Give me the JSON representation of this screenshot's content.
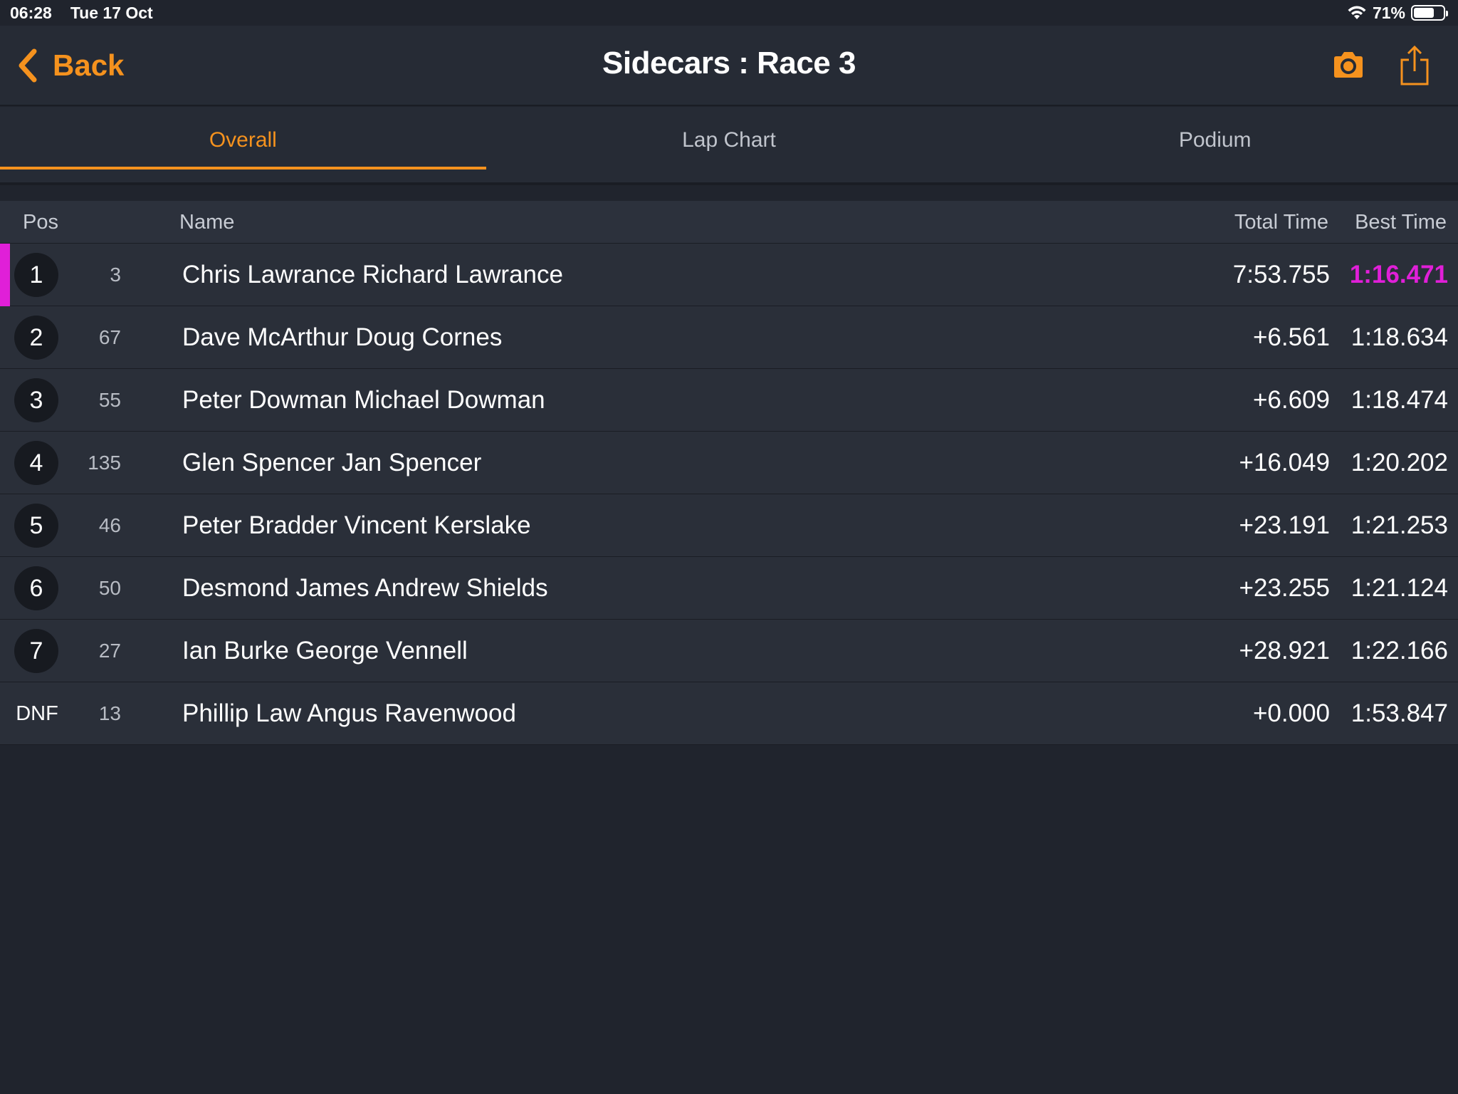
{
  "status_bar": {
    "time": "06:28",
    "date": "Tue 17 Oct",
    "battery": "71%",
    "battery_level": 0.71
  },
  "nav": {
    "back_label": "Back",
    "title": "Sidecars : Race 3",
    "accent_color": "#f5921e"
  },
  "tabs": [
    {
      "label": "Overall",
      "active": true
    },
    {
      "label": "Lap Chart",
      "active": false
    },
    {
      "label": "Podium",
      "active": false
    }
  ],
  "table": {
    "headers": {
      "pos": "Pos",
      "name": "Name",
      "total": "Total Time",
      "best": "Best Time"
    },
    "fastest_color": "#e01fd8",
    "rows": [
      {
        "pos": "1",
        "number": "3",
        "name": "Chris Lawrance Richard Lawrance",
        "total": "7:53.755",
        "best": "1:16.471"
      },
      {
        "pos": "2",
        "number": "67",
        "name": "Dave McArthur Doug Cornes",
        "total": "+6.561",
        "best": "1:18.634"
      },
      {
        "pos": "3",
        "number": "55",
        "name": "Peter Dowman Michael Dowman",
        "total": "+6.609",
        "best": "1:18.474"
      },
      {
        "pos": "4",
        "number": "135",
        "name": "Glen Spencer Jan Spencer",
        "total": "+16.049",
        "best": "1:20.202"
      },
      {
        "pos": "5",
        "number": "46",
        "name": "Peter Bradder Vincent Kerslake",
        "total": "+23.191",
        "best": "1:21.253"
      },
      {
        "pos": "6",
        "number": "50",
        "name": "Desmond James Andrew Shields",
        "total": "+23.255",
        "best": "1:21.124"
      },
      {
        "pos": "7",
        "number": "27",
        "name": "Ian Burke George Vennell",
        "total": "+28.921",
        "best": "1:22.166"
      },
      {
        "pos": "DNF",
        "number": "13",
        "name": "Phillip Law Angus Ravenwood",
        "total": "+0.000",
        "best": "1:53.847"
      }
    ]
  }
}
